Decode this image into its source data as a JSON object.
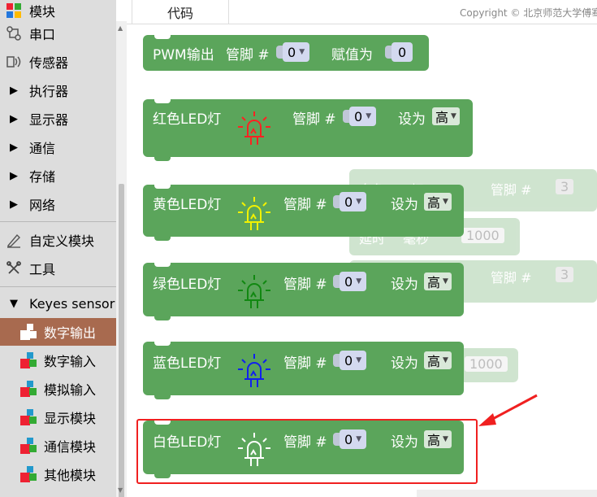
{
  "sidebar": {
    "top_label": "模块",
    "items": [
      {
        "label": "串口",
        "icon": "serial-port-icon"
      },
      {
        "label": "传感器",
        "icon": "sensor-icon"
      },
      {
        "label": "执行器",
        "icon": "expand-arrow-icon"
      },
      {
        "label": "显示器",
        "icon": "expand-arrow-icon"
      },
      {
        "label": "通信",
        "icon": "expand-arrow-icon"
      },
      {
        "label": "存储",
        "icon": "expand-arrow-icon"
      },
      {
        "label": "网络",
        "icon": "expand-arrow-icon"
      },
      {
        "label": "自定义模块",
        "icon": "pen-icon"
      },
      {
        "label": "工具",
        "icon": "tools-icon"
      },
      {
        "label": "Keyes sensor",
        "icon": "collapse-arrow-icon"
      }
    ],
    "sub_items": [
      {
        "label": "数字输出",
        "icon": "module-block-icon",
        "selected": true
      },
      {
        "label": "数字输入",
        "icon": "module-block-icon"
      },
      {
        "label": "模拟输入",
        "icon": "module-block-icon"
      },
      {
        "label": "显示模块",
        "icon": "module-block-icon"
      },
      {
        "label": "通信模块",
        "icon": "module-block-icon"
      },
      {
        "label": "其他模块",
        "icon": "module-block-icon"
      }
    ]
  },
  "topbar": {
    "tab_label": "代码",
    "copyright": "Copyright © 北京师范大学傅骞"
  },
  "blocks": {
    "pwm": {
      "label": "PWM输出",
      "pin_label": "管脚 #",
      "pin_value": "0",
      "assign_label": "赋值为",
      "assign_value": "0"
    },
    "red": {
      "label": "红色LED灯",
      "pin_label": "管脚 #",
      "pin_value": "0",
      "set_label": "设为",
      "set_value": "高",
      "color": "#ff2222"
    },
    "yellow": {
      "label": "黄色LED灯",
      "pin_label": "管脚 #",
      "pin_value": "0",
      "set_label": "设为",
      "set_value": "高",
      "color": "#f2f200"
    },
    "green": {
      "label": "绿色LED灯",
      "pin_label": "管脚 #",
      "pin_value": "0",
      "set_label": "设为",
      "set_value": "高",
      "color": "#118811"
    },
    "blue": {
      "label": "蓝色LED灯",
      "pin_label": "管脚 #",
      "pin_value": "0",
      "set_label": "设为",
      "set_value": "高",
      "color": "#1020ee"
    },
    "white": {
      "label": "白色LED灯",
      "pin_label": "管脚 #",
      "pin_value": "0",
      "set_label": "设为",
      "set_value": "高",
      "color": "#ffffff"
    }
  },
  "ghost": {
    "led_label": "白色LED灯",
    "pin_label": "管脚 #",
    "pin_value": "3",
    "delay_label": "延时",
    "delay_unit": "毫秒",
    "delay_value": "1000",
    "delay_value2": "1000"
  },
  "colors": {
    "block_green": "#5ba55b",
    "highlight": "#f02020",
    "selected_item": "#a86a4f"
  }
}
